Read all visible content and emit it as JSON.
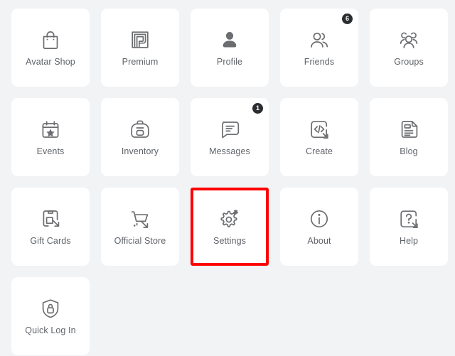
{
  "theme": {
    "background": "#f1f3f5",
    "tile_background": "#ffffff",
    "icon_color": "#6b6d70",
    "label_color": "#5f6368",
    "badge_background": "#2b2d30",
    "badge_text": "#ffffff",
    "highlight_border": "#fe0000"
  },
  "grid": {
    "columns": 5,
    "rows": 4,
    "tile_count": 16
  },
  "tiles": [
    {
      "label": "Avatar Shop",
      "icon": "shopping-bag-icon",
      "badge": null,
      "highlighted": false
    },
    {
      "label": "Premium",
      "icon": "premium-spiral-icon",
      "badge": null,
      "highlighted": false
    },
    {
      "label": "Profile",
      "icon": "person-filled-icon",
      "badge": null,
      "highlighted": false
    },
    {
      "label": "Friends",
      "icon": "two-people-icon",
      "badge": "6",
      "highlighted": false
    },
    {
      "label": "Groups",
      "icon": "three-people-icon",
      "badge": null,
      "highlighted": false
    },
    {
      "label": "Events",
      "icon": "calendar-star-icon",
      "badge": null,
      "highlighted": false
    },
    {
      "label": "Inventory",
      "icon": "backpack-icon",
      "badge": null,
      "highlighted": false
    },
    {
      "label": "Messages",
      "icon": "speech-bubble-icon",
      "badge": "1",
      "highlighted": false
    },
    {
      "label": "Create",
      "icon": "code-brackets-icon",
      "badge": null,
      "highlighted": false
    },
    {
      "label": "Blog",
      "icon": "document-icon",
      "badge": null,
      "highlighted": false
    },
    {
      "label": "Gift Cards",
      "icon": "gift-card-icon",
      "badge": null,
      "highlighted": false
    },
    {
      "label": "Official Store",
      "icon": "shopping-cart-icon",
      "badge": null,
      "highlighted": false
    },
    {
      "label": "Settings",
      "icon": "gear-icon",
      "badge": null,
      "highlighted": true
    },
    {
      "label": "About",
      "icon": "info-circle-icon",
      "badge": null,
      "highlighted": false
    },
    {
      "label": "Help",
      "icon": "question-mark-icon",
      "badge": null,
      "highlighted": false
    },
    {
      "label": "Quick Log In",
      "icon": "shield-lock-icon",
      "badge": null,
      "highlighted": false
    }
  ]
}
